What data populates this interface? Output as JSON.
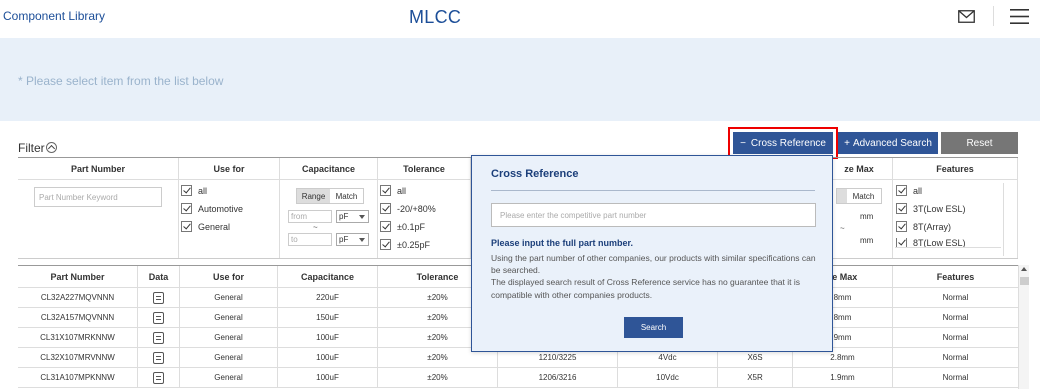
{
  "header": {
    "brand": "Component Library",
    "title": "MLCC",
    "icons": [
      "mail-icon",
      "menu-icon"
    ]
  },
  "banner": {
    "text": "* Please select item from the list below"
  },
  "filter": {
    "label": "Filter",
    "columns": {
      "part_number": "Part Number",
      "use_for": "Use for",
      "capacitance": "Capacitance",
      "tolerance": "Tolerance",
      "size_max": "ze Max",
      "features": "Features"
    },
    "part_number_placeholder": "Part Number Keyword",
    "use_for_options": [
      "all",
      "Automotive",
      "General"
    ],
    "capacitance": {
      "range_label": "Range",
      "match_label": "Match",
      "from_placeholder": "from",
      "to_placeholder": "to",
      "unit": "pF",
      "tilde": "~"
    },
    "tolerance_options": [
      "all",
      "-20/+80%",
      "±0.1pF",
      "±0.25pF"
    ],
    "size_max": {
      "match_label": "Match",
      "unit": "mm",
      "tilde": "~"
    },
    "feature_options": [
      "all",
      "3T(Low ESL)",
      "8T(Array)",
      "8T(Low ESL)"
    ]
  },
  "actions": {
    "cross_reference": "Cross Reference",
    "advanced_search": "Advanced Search",
    "reset": "Reset"
  },
  "results": {
    "headers": [
      "Part Number",
      "Data",
      "Use for",
      "Capacitance",
      "Tolerance",
      "",
      "",
      "",
      "ze Max",
      "Features"
    ],
    "rows": [
      [
        "CL32A227MQVNNN",
        "",
        "General",
        "220uF",
        "±20%",
        "",
        "",
        "",
        "8mm",
        "Normal"
      ],
      [
        "CL32A157MQVNNN",
        "",
        "General",
        "150uF",
        "±20%",
        "",
        "",
        "",
        "8mm",
        "Normal"
      ],
      [
        "CL31X107MRKNNW",
        "",
        "General",
        "100uF",
        "±20%",
        "",
        "",
        "",
        "9mm",
        "Normal"
      ],
      [
        "CL32X107MRVNNW",
        "",
        "General",
        "100uF",
        "±20%",
        "1210/3225",
        "4Vdc",
        "X6S",
        "2.8mm",
        "Normal"
      ],
      [
        "CL31A107MPKNNW",
        "",
        "General",
        "100uF",
        "±20%",
        "1206/3216",
        "10Vdc",
        "X5R",
        "1.9mm",
        "Normal"
      ]
    ]
  },
  "modal": {
    "title": "Cross Reference",
    "input_placeholder": "Please enter the competitive part number",
    "note": "Please input the full part number.",
    "desc_1": "Using the part number of other companies, our products with similar specifications can be searched.",
    "desc_2": "The displayed search result of Cross Reference service has no guarantee that it is compatible with other companies products.",
    "search_label": "Search"
  },
  "colors": {
    "brand_blue": "#2f5597",
    "reset_gray": "#767676",
    "banner_bg": "#e8f0f9",
    "highlight_red": "#ee0000"
  }
}
